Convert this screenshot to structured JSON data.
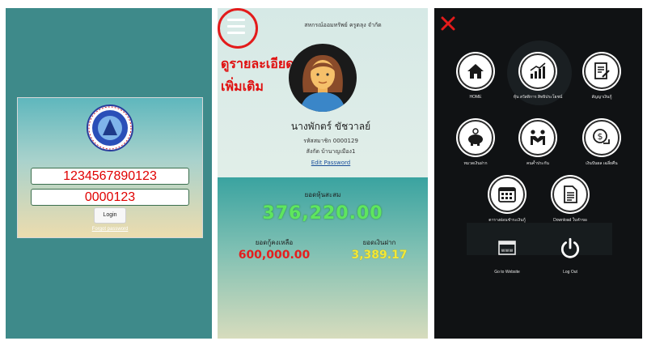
{
  "login": {
    "member_id": "1234567890123",
    "password": "0000123",
    "login_label": "Login",
    "forgot_label": "Forgot password"
  },
  "profile": {
    "coop_name": "สหกรณ์ออมทรัพย์ ครูตลุง จำกัด",
    "annotation_line1": "ดูรายละเอียด",
    "annotation_line2": "เพิ่มเติม",
    "name": "นางพักตร์ ขัชวาลย์",
    "member_no": "รหัสสมาชิก 0000129",
    "affiliation": "สังกัด บ้านาญเมือง1",
    "edit_password": "Edit Password",
    "shares_label": "ยอดหุ้นสะสม",
    "shares_value": "376,220.00",
    "loan_label": "ยอดกู้คงเหลือ",
    "loan_value": "600,000.00",
    "deposit_label": "ยอดเงินฝาก",
    "deposit_value": "3,389.17"
  },
  "menu": {
    "items": [
      {
        "label": "HOME",
        "icon": "home-icon"
      },
      {
        "label": "หุ้น สวัสดิการ สิทธิประโยชน์",
        "icon": "growth-chart-icon"
      },
      {
        "label": "สัญญาเงินกู้",
        "icon": "contract-icon"
      },
      {
        "label": "หมวดเงินฝาก",
        "icon": "piggy-bank-icon"
      },
      {
        "label": "คนค้ำประกัน",
        "icon": "guarantor-icon"
      },
      {
        "label": "เงินปันผล เฉลี่ยคืน",
        "icon": "dividend-icon"
      },
      {
        "label": "ตารางผ่อนชำระเงินกู้",
        "icon": "calendar-icon"
      },
      {
        "label": "Download ใบคำขอ",
        "icon": "document-icon"
      },
      {
        "label": "Go to Website",
        "icon": "website-icon"
      },
      {
        "label": "Log Out",
        "icon": "power-icon"
      }
    ]
  },
  "colors": {
    "login_bg": "#3e8a8a",
    "accent_red": "#e31b1b",
    "shares_green": "#5ee65e",
    "loan_red": "#e41e1e",
    "deposit_yellow": "#f3e838",
    "menu_bg": "#101214"
  }
}
